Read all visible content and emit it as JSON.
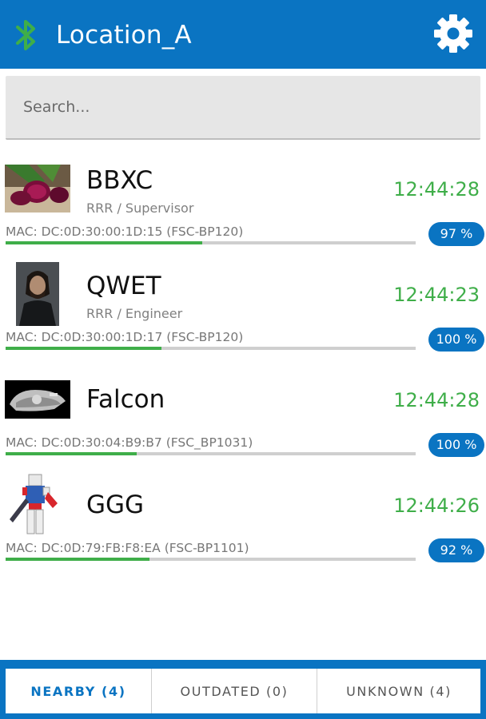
{
  "header": {
    "title": "Location_A",
    "bluetooth_icon": "bluetooth-icon",
    "settings_icon": "gear-icon",
    "bluetooth_color": "#3fae49",
    "bar_color": "#0a74c2"
  },
  "search": {
    "placeholder": "Search..."
  },
  "devices": [
    {
      "name": "BBXC",
      "subtitle": "RRR / Supervisor",
      "time": "12:44:28",
      "mac": "MAC: DC:0D:30:00:1D:15 (FSC-BP120)",
      "percent_label": "97 %",
      "signal_fraction": 0.48,
      "thumbnail": "beets-photo"
    },
    {
      "name": "QWET",
      "subtitle": "RRR / Engineer",
      "time": "12:44:23",
      "mac": "MAC: DC:0D:30:00:1D:17 (FSC-BP120)",
      "percent_label": "100 %",
      "signal_fraction": 0.38,
      "thumbnail": "portrait-photo"
    },
    {
      "name": "Falcon",
      "subtitle": "",
      "time": "12:44:28",
      "mac": "MAC: DC:0D:30:04:B9:B7 (FSC_BP1031)",
      "percent_label": "100 %",
      "signal_fraction": 0.32,
      "thumbnail": "spaceship-photo"
    },
    {
      "name": "GGG",
      "subtitle": "",
      "time": "12:44:26",
      "mac": "MAC: DC:0D:79:FB:F8:EA (FSC-BP1101)",
      "percent_label": "92 %",
      "signal_fraction": 0.35,
      "thumbnail": "robot-photo"
    }
  ],
  "tabs": [
    {
      "label": "NEARBY (4)",
      "active": true
    },
    {
      "label": "OUTDATED (0)",
      "active": false
    },
    {
      "label": "UNKNOWN (4)",
      "active": false
    }
  ],
  "colors": {
    "accent": "#0a74c2",
    "time_green": "#3fae49",
    "progress_green": "#3fae49"
  }
}
